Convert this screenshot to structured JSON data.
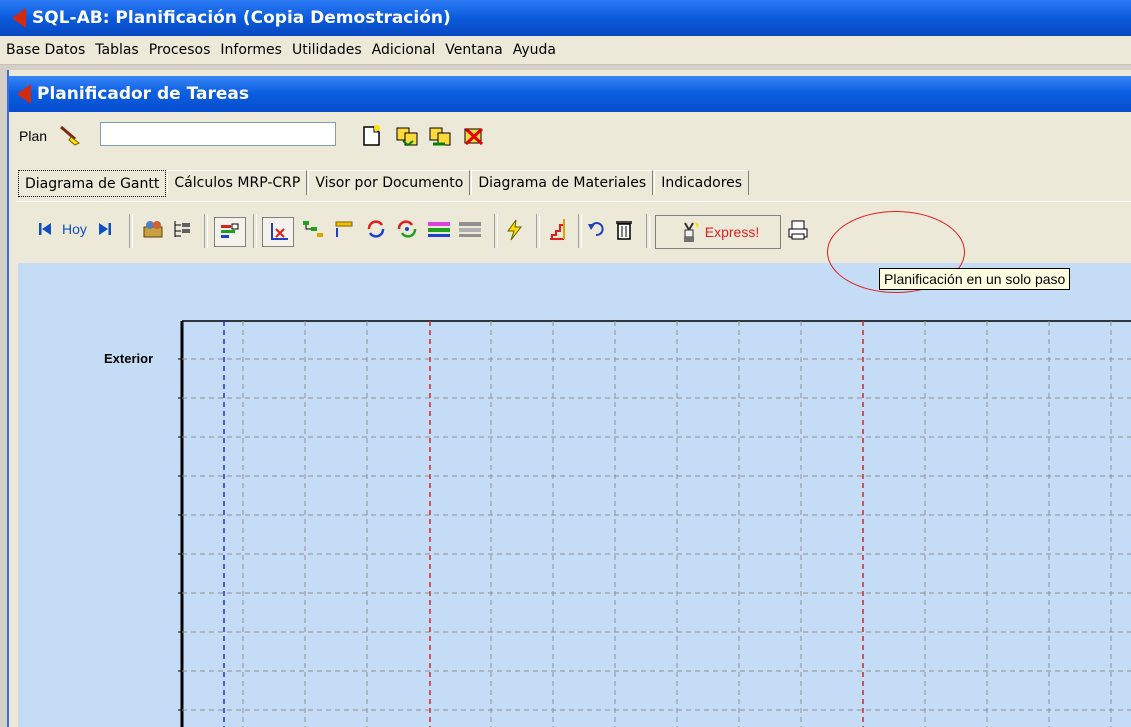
{
  "window": {
    "title": "SQL-AB: Planificación (Copia Demostración)"
  },
  "menu": [
    "Base Datos",
    "Tablas",
    "Procesos",
    "Informes",
    "Utilidades",
    "Adicional",
    "Ventana",
    "Ayuda"
  ],
  "child": {
    "title": "Planificador de Tareas"
  },
  "plan": {
    "label": "Plan",
    "value": ""
  },
  "tabs": [
    "Diagrama de Gantt",
    "Cálculos MRP-CRP",
    "Visor por Documento",
    "Diagrama de Materiales",
    "Indicadores"
  ],
  "toolbar": {
    "today_label": "Hoy",
    "express_label": "Express!"
  },
  "tooltip": "Planificación en un solo paso",
  "gantt": {
    "row_label": "Exterior"
  },
  "colors": {
    "accent": "#0a5bdc",
    "chart_bg": "#c4dcf6",
    "highlight": "#e02020"
  }
}
